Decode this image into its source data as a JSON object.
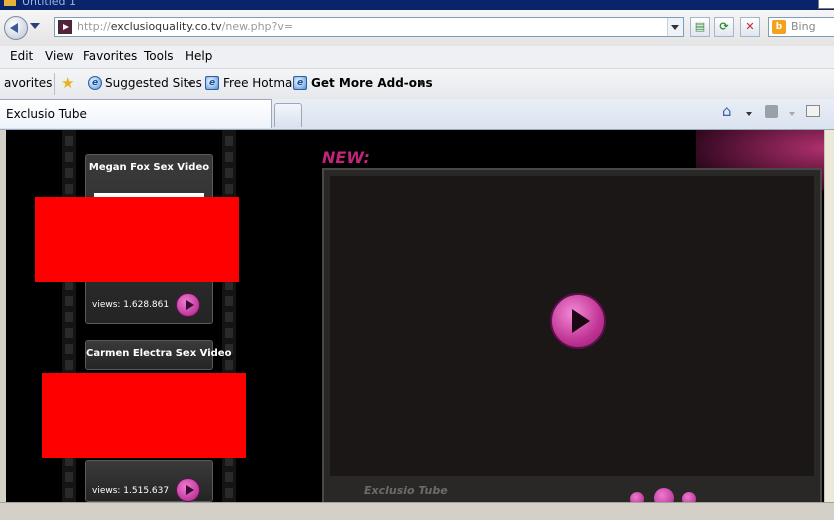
{
  "window": {
    "title": "Untitled 1"
  },
  "address_bar": {
    "url_scheme": "http://",
    "url_domain": "exclusioquality.co.tv",
    "url_path": "/new.php?v="
  },
  "search": {
    "provider": "Bing"
  },
  "menu": [
    "Edit",
    "View",
    "Favorites",
    "Tools",
    "Help"
  ],
  "favorites_bar": {
    "favorites_label": "avorites",
    "items": [
      {
        "label": "Suggested Sites",
        "icon": "ie-icon",
        "has_dropdown": true
      },
      {
        "label": "Free Hotmail",
        "icon": "ie-page-icon",
        "has_dropdown": false
      },
      {
        "label": "Get More Add-ons",
        "icon": "ie-page-icon",
        "has_dropdown": true
      }
    ]
  },
  "tabs": [
    {
      "label": "Exclusio Tube",
      "active": true
    }
  ],
  "page": {
    "new_label": "NEW:",
    "brand": "Exclusio Tube",
    "videos": [
      {
        "title": "Megan Fox Sex Video",
        "views": "views: 1.628.861"
      },
      {
        "title": "Carmen Electra Sex Video",
        "views": "views: 1.515.637"
      }
    ]
  },
  "colors": {
    "accent_pink": "#c2247c",
    "thumbnail_red": "#ff0000",
    "page_background": "#000000"
  }
}
